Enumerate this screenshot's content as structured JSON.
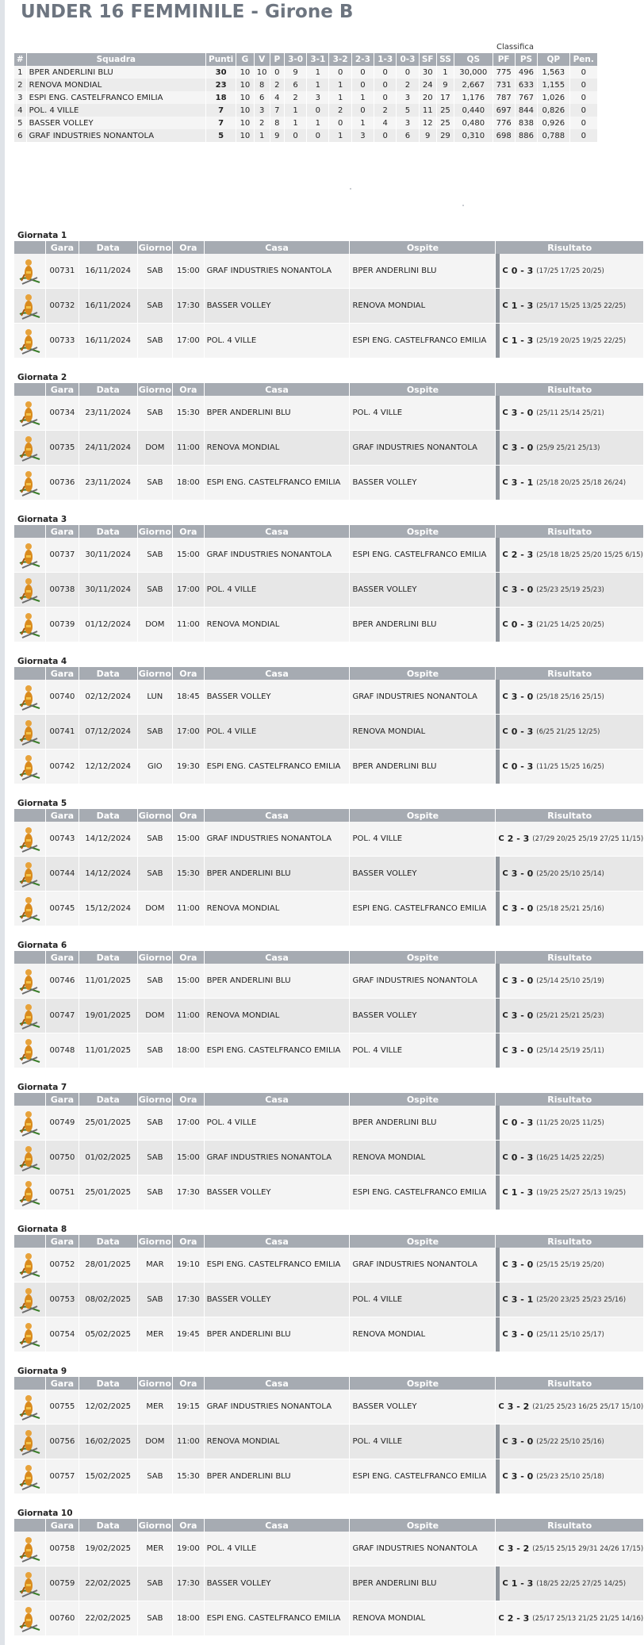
{
  "title": "UNDER 16 FEMMINILE - Girone B",
  "classifica_label": "Classifica",
  "standings": {
    "headers": [
      "#",
      "Squadra",
      "Punti",
      "G",
      "V",
      "P",
      "3-0",
      "3-1",
      "3-2",
      "2-3",
      "1-3",
      "0-3",
      "SF",
      "SS",
      "QS",
      "PF",
      "PS",
      "QP",
      "Pen."
    ],
    "rows": [
      [
        "1",
        "BPER ANDERLINI BLU",
        "30",
        "10",
        "10",
        "0",
        "9",
        "1",
        "0",
        "0",
        "0",
        "0",
        "30",
        "1",
        "30,000",
        "775",
        "496",
        "1,563",
        "0"
      ],
      [
        "2",
        "RENOVA MONDIAL",
        "23",
        "10",
        "8",
        "2",
        "6",
        "1",
        "1",
        "0",
        "0",
        "2",
        "24",
        "9",
        "2,667",
        "731",
        "633",
        "1,155",
        "0"
      ],
      [
        "3",
        "ESPI ENG. CASTELFRANCO EMILIA",
        "18",
        "10",
        "6",
        "4",
        "2",
        "3",
        "1",
        "1",
        "0",
        "3",
        "20",
        "17",
        "1,176",
        "787",
        "767",
        "1,026",
        "0"
      ],
      [
        "4",
        "POL. 4 VILLE",
        "7",
        "10",
        "3",
        "7",
        "1",
        "0",
        "2",
        "0",
        "2",
        "5",
        "11",
        "25",
        "0,440",
        "697",
        "844",
        "0,826",
        "0"
      ],
      [
        "5",
        "BASSER VOLLEY",
        "7",
        "10",
        "2",
        "8",
        "1",
        "1",
        "0",
        "1",
        "4",
        "3",
        "12",
        "25",
        "0,480",
        "776",
        "838",
        "0,926",
        "0"
      ],
      [
        "6",
        "GRAF INDUSTRIES NONANTOLA",
        "5",
        "10",
        "1",
        "9",
        "0",
        "0",
        "1",
        "3",
        "0",
        "6",
        "9",
        "29",
        "0,310",
        "698",
        "886",
        "0,788",
        "0"
      ]
    ]
  },
  "game_headers": [
    "",
    "Gara",
    "Data",
    "Giorno",
    "Ora",
    "Casa",
    "Ospite",
    "Risultato"
  ],
  "icon": "referee-whistle-icon",
  "rounds": [
    {
      "title": "Giornata 1",
      "games": [
        {
          "gara": "00731",
          "data": "16/11/2024",
          "giorno": "SAB",
          "ora": "15:00",
          "casa": "GRAF INDUSTRIES NONANTOLA",
          "ospite": "BPER ANDERLINI BLU",
          "flag": "C",
          "score": "0 - 3",
          "sets": "(17/25 17/25 20/25)"
        },
        {
          "gara": "00732",
          "data": "16/11/2024",
          "giorno": "SAB",
          "ora": "17:30",
          "casa": "BASSER VOLLEY",
          "ospite": "RENOVA MONDIAL",
          "flag": "C",
          "score": "1 - 3",
          "sets": "(25/17 15/25 13/25 22/25)"
        },
        {
          "gara": "00733",
          "data": "16/11/2024",
          "giorno": "SAB",
          "ora": "17:00",
          "casa": "POL. 4 VILLE",
          "ospite": "ESPI ENG. CASTELFRANCO EMILIA",
          "flag": "C",
          "score": "1 - 3",
          "sets": "(25/19 20/25 19/25 22/25)"
        }
      ]
    },
    {
      "title": "Giornata 2",
      "games": [
        {
          "gara": "00734",
          "data": "23/11/2024",
          "giorno": "SAB",
          "ora": "15:30",
          "casa": "BPER ANDERLINI BLU",
          "ospite": "POL. 4 VILLE",
          "flag": "C",
          "score": "3 - 0",
          "sets": "(25/11 25/14 25/21)"
        },
        {
          "gara": "00735",
          "data": "24/11/2024",
          "giorno": "DOM",
          "ora": "11:00",
          "casa": "RENOVA MONDIAL",
          "ospite": "GRAF INDUSTRIES NONANTOLA",
          "flag": "C",
          "score": "3 - 0",
          "sets": "(25/9 25/21 25/13)"
        },
        {
          "gara": "00736",
          "data": "23/11/2024",
          "giorno": "SAB",
          "ora": "18:00",
          "casa": "ESPI ENG. CASTELFRANCO EMILIA",
          "ospite": "BASSER VOLLEY",
          "flag": "C",
          "score": "3 - 1",
          "sets": "(25/18 20/25 25/18 26/24)"
        }
      ]
    },
    {
      "title": "Giornata 3",
      "games": [
        {
          "gara": "00737",
          "data": "30/11/2024",
          "giorno": "SAB",
          "ora": "15:00",
          "casa": "GRAF INDUSTRIES NONANTOLA",
          "ospite": "ESPI ENG. CASTELFRANCO EMILIA",
          "flag": "C",
          "score": "2 - 3",
          "sets": "(25/18 18/25 25/20 15/25 6/15)"
        },
        {
          "gara": "00738",
          "data": "30/11/2024",
          "giorno": "SAB",
          "ora": "17:00",
          "casa": "POL. 4 VILLE",
          "ospite": "BASSER VOLLEY",
          "flag": "C",
          "score": "3 - 0",
          "sets": "(25/23 25/19 25/23)"
        },
        {
          "gara": "00739",
          "data": "01/12/2024",
          "giorno": "DOM",
          "ora": "11:00",
          "casa": "RENOVA MONDIAL",
          "ospite": "BPER ANDERLINI BLU",
          "flag": "C",
          "score": "0 - 3",
          "sets": "(21/25 14/25 20/25)"
        }
      ]
    },
    {
      "title": "Giornata 4",
      "games": [
        {
          "gara": "00740",
          "data": "02/12/2024",
          "giorno": "LUN",
          "ora": "18:45",
          "casa": "BASSER VOLLEY",
          "ospite": "GRAF INDUSTRIES NONANTOLA",
          "flag": "C",
          "score": "3 - 0",
          "sets": "(25/18 25/16 25/15)"
        },
        {
          "gara": "00741",
          "data": "07/12/2024",
          "giorno": "SAB",
          "ora": "17:00",
          "casa": "POL. 4 VILLE",
          "ospite": "RENOVA MONDIAL",
          "flag": "C",
          "score": "0 - 3",
          "sets": "(6/25 21/25 12/25)"
        },
        {
          "gara": "00742",
          "data": "12/12/2024",
          "giorno": "GIO",
          "ora": "19:30",
          "casa": "ESPI ENG. CASTELFRANCO EMILIA",
          "ospite": "BPER ANDERLINI BLU",
          "flag": "C",
          "score": "0 - 3",
          "sets": "(11/25 15/25 16/25)"
        }
      ]
    },
    {
      "title": "Giornata 5",
      "games": [
        {
          "gara": "00743",
          "data": "14/12/2024",
          "giorno": "SAB",
          "ora": "15:00",
          "casa": "GRAF INDUSTRIES NONANTOLA",
          "ospite": "POL. 4 VILLE",
          "flag": "C",
          "score": "2 - 3",
          "sets": "(27/29 20/25 25/19 27/25 11/15)"
        },
        {
          "gara": "00744",
          "data": "14/12/2024",
          "giorno": "SAB",
          "ora": "15:30",
          "casa": "BPER ANDERLINI BLU",
          "ospite": "BASSER VOLLEY",
          "flag": "C",
          "score": "3 - 0",
          "sets": "(25/20 25/10 25/14)"
        },
        {
          "gara": "00745",
          "data": "15/12/2024",
          "giorno": "DOM",
          "ora": "11:00",
          "casa": "RENOVA MONDIAL",
          "ospite": "ESPI ENG. CASTELFRANCO EMILIA",
          "flag": "C",
          "score": "3 - 0",
          "sets": "(25/18 25/21 25/16)"
        }
      ]
    },
    {
      "title": "Giornata 6",
      "games": [
        {
          "gara": "00746",
          "data": "11/01/2025",
          "giorno": "SAB",
          "ora": "15:00",
          "casa": "BPER ANDERLINI BLU",
          "ospite": "GRAF INDUSTRIES NONANTOLA",
          "flag": "C",
          "score": "3 - 0",
          "sets": "(25/14 25/10 25/19)"
        },
        {
          "gara": "00747",
          "data": "19/01/2025",
          "giorno": "DOM",
          "ora": "11:00",
          "casa": "RENOVA MONDIAL",
          "ospite": "BASSER VOLLEY",
          "flag": "C",
          "score": "3 - 0",
          "sets": "(25/21 25/21 25/23)"
        },
        {
          "gara": "00748",
          "data": "11/01/2025",
          "giorno": "SAB",
          "ora": "18:00",
          "casa": "ESPI ENG. CASTELFRANCO EMILIA",
          "ospite": "POL. 4 VILLE",
          "flag": "C",
          "score": "3 - 0",
          "sets": "(25/14 25/19 25/11)"
        }
      ]
    },
    {
      "title": "Giornata 7",
      "games": [
        {
          "gara": "00749",
          "data": "25/01/2025",
          "giorno": "SAB",
          "ora": "17:00",
          "casa": "POL. 4 VILLE",
          "ospite": "BPER ANDERLINI BLU",
          "flag": "C",
          "score": "0 - 3",
          "sets": "(11/25 20/25 11/25)"
        },
        {
          "gara": "00750",
          "data": "01/02/2025",
          "giorno": "SAB",
          "ora": "15:00",
          "casa": "GRAF INDUSTRIES NONANTOLA",
          "ospite": "RENOVA MONDIAL",
          "flag": "C",
          "score": "0 - 3",
          "sets": "(16/25 14/25 22/25)"
        },
        {
          "gara": "00751",
          "data": "25/01/2025",
          "giorno": "SAB",
          "ora": "17:30",
          "casa": "BASSER VOLLEY",
          "ospite": "ESPI ENG. CASTELFRANCO EMILIA",
          "flag": "C",
          "score": "1 - 3",
          "sets": "(19/25 25/27 25/13 19/25)"
        }
      ]
    },
    {
      "title": "Giornata 8",
      "games": [
        {
          "gara": "00752",
          "data": "28/01/2025",
          "giorno": "MAR",
          "ora": "19:10",
          "casa": "ESPI ENG. CASTELFRANCO EMILIA",
          "ospite": "GRAF INDUSTRIES NONANTOLA",
          "flag": "C",
          "score": "3 - 0",
          "sets": "(25/15 25/19 25/20)"
        },
        {
          "gara": "00753",
          "data": "08/02/2025",
          "giorno": "SAB",
          "ora": "17:30",
          "casa": "BASSER VOLLEY",
          "ospite": "POL. 4 VILLE",
          "flag": "C",
          "score": "3 - 1",
          "sets": "(25/20 23/25 25/23 25/16)"
        },
        {
          "gara": "00754",
          "data": "05/02/2025",
          "giorno": "MER",
          "ora": "19:45",
          "casa": "BPER ANDERLINI BLU",
          "ospite": "RENOVA MONDIAL",
          "flag": "C",
          "score": "3 - 0",
          "sets": "(25/11 25/10 25/17)"
        }
      ]
    },
    {
      "title": "Giornata 9",
      "games": [
        {
          "gara": "00755",
          "data": "12/02/2025",
          "giorno": "MER",
          "ora": "19:15",
          "casa": "GRAF INDUSTRIES NONANTOLA",
          "ospite": "BASSER VOLLEY",
          "flag": "C",
          "score": "3 - 2",
          "sets": "(21/25 25/23 16/25 25/17 15/10)"
        },
        {
          "gara": "00756",
          "data": "16/02/2025",
          "giorno": "DOM",
          "ora": "11:00",
          "casa": "RENOVA MONDIAL",
          "ospite": "POL. 4 VILLE",
          "flag": "C",
          "score": "3 - 0",
          "sets": "(25/22 25/10 25/16)"
        },
        {
          "gara": "00757",
          "data": "15/02/2025",
          "giorno": "SAB",
          "ora": "15:30",
          "casa": "BPER ANDERLINI BLU",
          "ospite": "ESPI ENG. CASTELFRANCO EMILIA",
          "flag": "C",
          "score": "3 - 0",
          "sets": "(25/23 25/10 25/18)"
        }
      ]
    },
    {
      "title": "Giornata 10",
      "games": [
        {
          "gara": "00758",
          "data": "19/02/2025",
          "giorno": "MER",
          "ora": "19:00",
          "casa": "POL. 4 VILLE",
          "ospite": "GRAF INDUSTRIES NONANTOLA",
          "flag": "C",
          "score": "3 - 2",
          "sets": "(25/15 25/15 29/31 24/26 17/15)"
        },
        {
          "gara": "00759",
          "data": "22/02/2025",
          "giorno": "SAB",
          "ora": "17:30",
          "casa": "BASSER VOLLEY",
          "ospite": "BPER ANDERLINI BLU",
          "flag": "C",
          "score": "1 - 3",
          "sets": "(18/25 22/25 27/25 14/25)"
        },
        {
          "gara": "00760",
          "data": "22/02/2025",
          "giorno": "SAB",
          "ora": "18:00",
          "casa": "ESPI ENG. CASTELFRANCO EMILIA",
          "ospite": "RENOVA MONDIAL",
          "flag": "C",
          "score": "2 - 3",
          "sets": "(25/17 25/13 21/25 21/25 14/16)"
        }
      ]
    }
  ]
}
